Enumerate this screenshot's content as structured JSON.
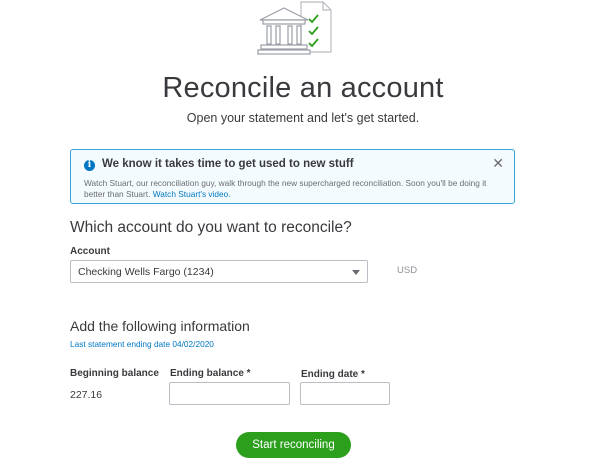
{
  "header": {
    "icon": "bank-with-checklist-icon",
    "title": "Reconcile an account",
    "subtitle": "Open your statement and let's get started."
  },
  "banner": {
    "icon": "info-icon",
    "title": "We know it takes time to get used to new stuff",
    "body": "Watch Stuart, our reconciliation guy, walk through the new supercharged reconciliation. Soon you'll be doing it better than Stuart.",
    "link": "Watch Stuart's video.",
    "close_icon": "close-icon",
    "accent_color": "#0077c5"
  },
  "account_section": {
    "heading": "Which account do you want to reconcile?",
    "account_label": "Account",
    "account_value": "Checking Wells Fargo (1234)",
    "currency": "USD"
  },
  "info_section": {
    "heading": "Add the following information",
    "last_statement_link": "Last statement ending date 04/02/2020",
    "beginning_balance_label": "Beginning balance",
    "beginning_balance_value": "227.16",
    "ending_balance_label": "Ending balance *",
    "ending_balance_value": "",
    "ending_date_label": "Ending date *",
    "ending_date_value": ""
  },
  "actions": {
    "start_label": "Start reconciling",
    "button_color": "#2ca01c"
  }
}
